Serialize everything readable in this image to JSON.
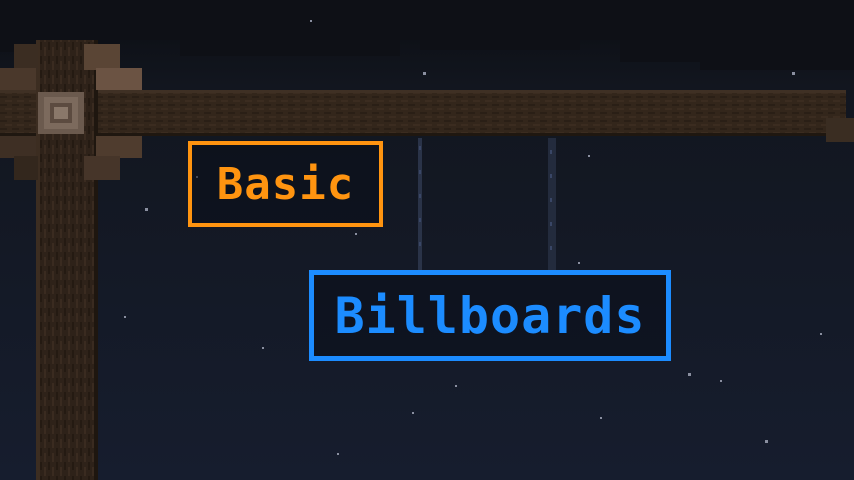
{
  "scene": {
    "description_colors": {
      "sky_top": "#0d0f14",
      "sky": "#141a2a",
      "wood_dark": "#2b2017",
      "wood_mid": "#3a2b1f",
      "wood_light": "#5a4535",
      "chain": "#2a3348"
    }
  },
  "signs": {
    "basic": {
      "label": "Basic",
      "color": "#ff9410"
    },
    "billboards": {
      "label": "Billboards",
      "color": "#1c8cff"
    }
  }
}
